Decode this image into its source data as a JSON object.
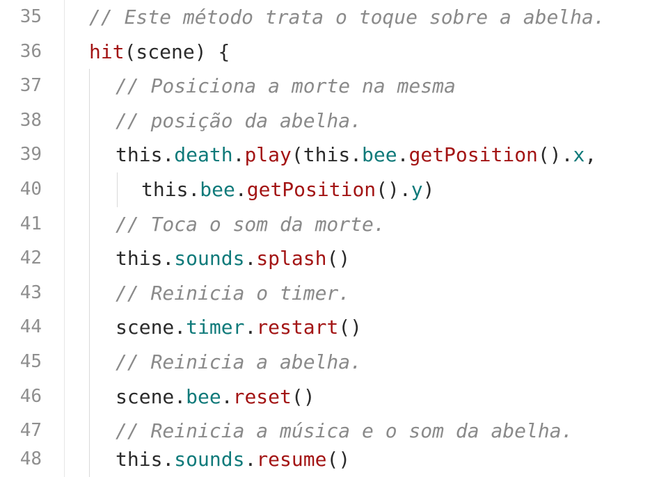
{
  "editor": {
    "colors": {
      "comment": "#8a8a8a",
      "function": "#a31515",
      "property": "#0f7a7a",
      "text": "#2b2b2b",
      "line_number": "#8f8f8f"
    },
    "lines": [
      {
        "num": "35",
        "tokens": [
          "// Este método trata o toque sobre a abelha."
        ]
      },
      {
        "num": "36",
        "tokens": [
          "hit",
          "(scene) {"
        ]
      },
      {
        "num": "37",
        "tokens": [
          "// Posiciona a morte na mesma"
        ]
      },
      {
        "num": "38",
        "tokens": [
          "// posição da abelha."
        ]
      },
      {
        "num": "39",
        "tokens": [
          "this.",
          "death",
          ".",
          "play",
          "(this.",
          "bee",
          ".",
          "getPosition",
          "().",
          "x",
          ","
        ]
      },
      {
        "num": "40",
        "tokens": [
          "this.",
          "bee",
          ".",
          "getPosition",
          "().",
          "y",
          ")"
        ]
      },
      {
        "num": "41",
        "tokens": [
          "// Toca o som da morte."
        ]
      },
      {
        "num": "42",
        "tokens": [
          "this.",
          "sounds",
          ".",
          "splash",
          "()"
        ]
      },
      {
        "num": "43",
        "tokens": [
          "// Reinicia o timer."
        ]
      },
      {
        "num": "44",
        "tokens": [
          "scene.",
          "timer",
          ".",
          "restart",
          "()"
        ]
      },
      {
        "num": "45",
        "tokens": [
          "// Reinicia a abelha."
        ]
      },
      {
        "num": "46",
        "tokens": [
          "scene.",
          "bee",
          ".",
          "reset",
          "()"
        ]
      },
      {
        "num": "47",
        "tokens": [
          "// Reinicia a música e o som da abelha."
        ]
      },
      {
        "num": "48",
        "tokens": [
          "this.",
          "sounds",
          ".",
          "resume",
          "()"
        ]
      }
    ]
  }
}
